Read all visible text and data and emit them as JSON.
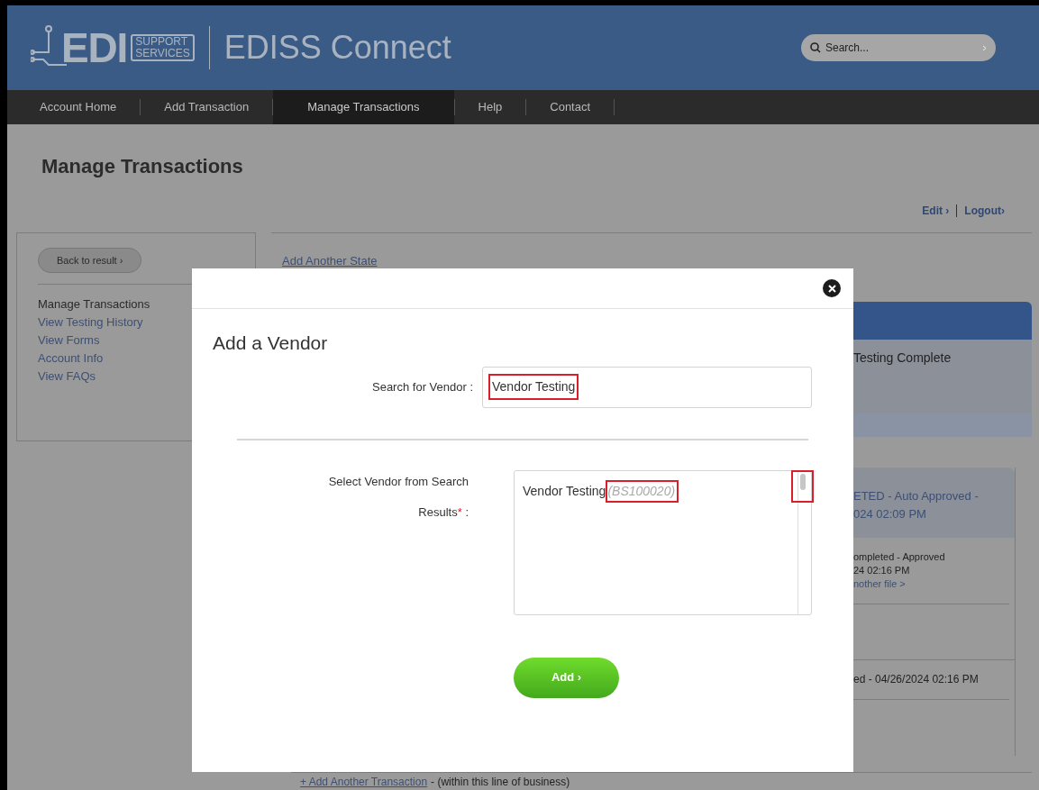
{
  "header": {
    "logo_main": "EDI",
    "logo_sub": [
      "SUPPORT",
      "SERVICES"
    ],
    "app_title": "EDISS Connect",
    "search": {
      "placeholder": "Search..."
    }
  },
  "nav": [
    {
      "label": "Account Home",
      "selected": false
    },
    {
      "label": "Add Transaction",
      "selected": false
    },
    {
      "label": "Manage Transactions",
      "selected": true
    },
    {
      "label": "Help",
      "selected": false
    },
    {
      "label": "Contact",
      "selected": false
    }
  ],
  "page": {
    "title": "Manage Transactions",
    "user_links": [
      "Edit ›",
      "Logout›"
    ]
  },
  "sidebar": {
    "back_button": "Back to result ›",
    "items": [
      {
        "label": "Manage Transactions",
        "selected": true
      },
      {
        "label": "View Testing History",
        "selected": false
      },
      {
        "label": "View Forms",
        "selected": false
      },
      {
        "label": "Account Info",
        "selected": false
      },
      {
        "label": "View FAQs",
        "selected": false
      }
    ]
  },
  "main": {
    "add_state_link": "Add Another State",
    "status_header": "Testing Complete",
    "card_header": [
      "ETED - Auto Approved -",
      "024 02:09 PM"
    ],
    "rows": [
      {
        "lines": [
          "ompleted - Approved",
          "24 02:16 PM"
        ],
        "link": "nother file >"
      },
      {
        "lines": []
      },
      {
        "lines": [
          "ed - 04/26/2024 02:16 PM"
        ]
      }
    ],
    "add_transaction": {
      "link": "+ Add Another Transaction",
      "note": "- (within this line of business)"
    }
  },
  "dialog": {
    "title": "Add a Vendor",
    "search": {
      "label": "Search for Vendor :",
      "value": "Vendor Testing",
      "highlighted": true
    },
    "results": {
      "label": "Select Vendor from Search",
      "label_line2": "Results",
      "required": "*",
      "colon": ":",
      "items": [
        {
          "name": "Vendor Testing",
          "code": "(BS100020)",
          "code_highlighted": true
        }
      ],
      "scrollbar_highlighted": true
    },
    "add_button": "Add ›"
  }
}
